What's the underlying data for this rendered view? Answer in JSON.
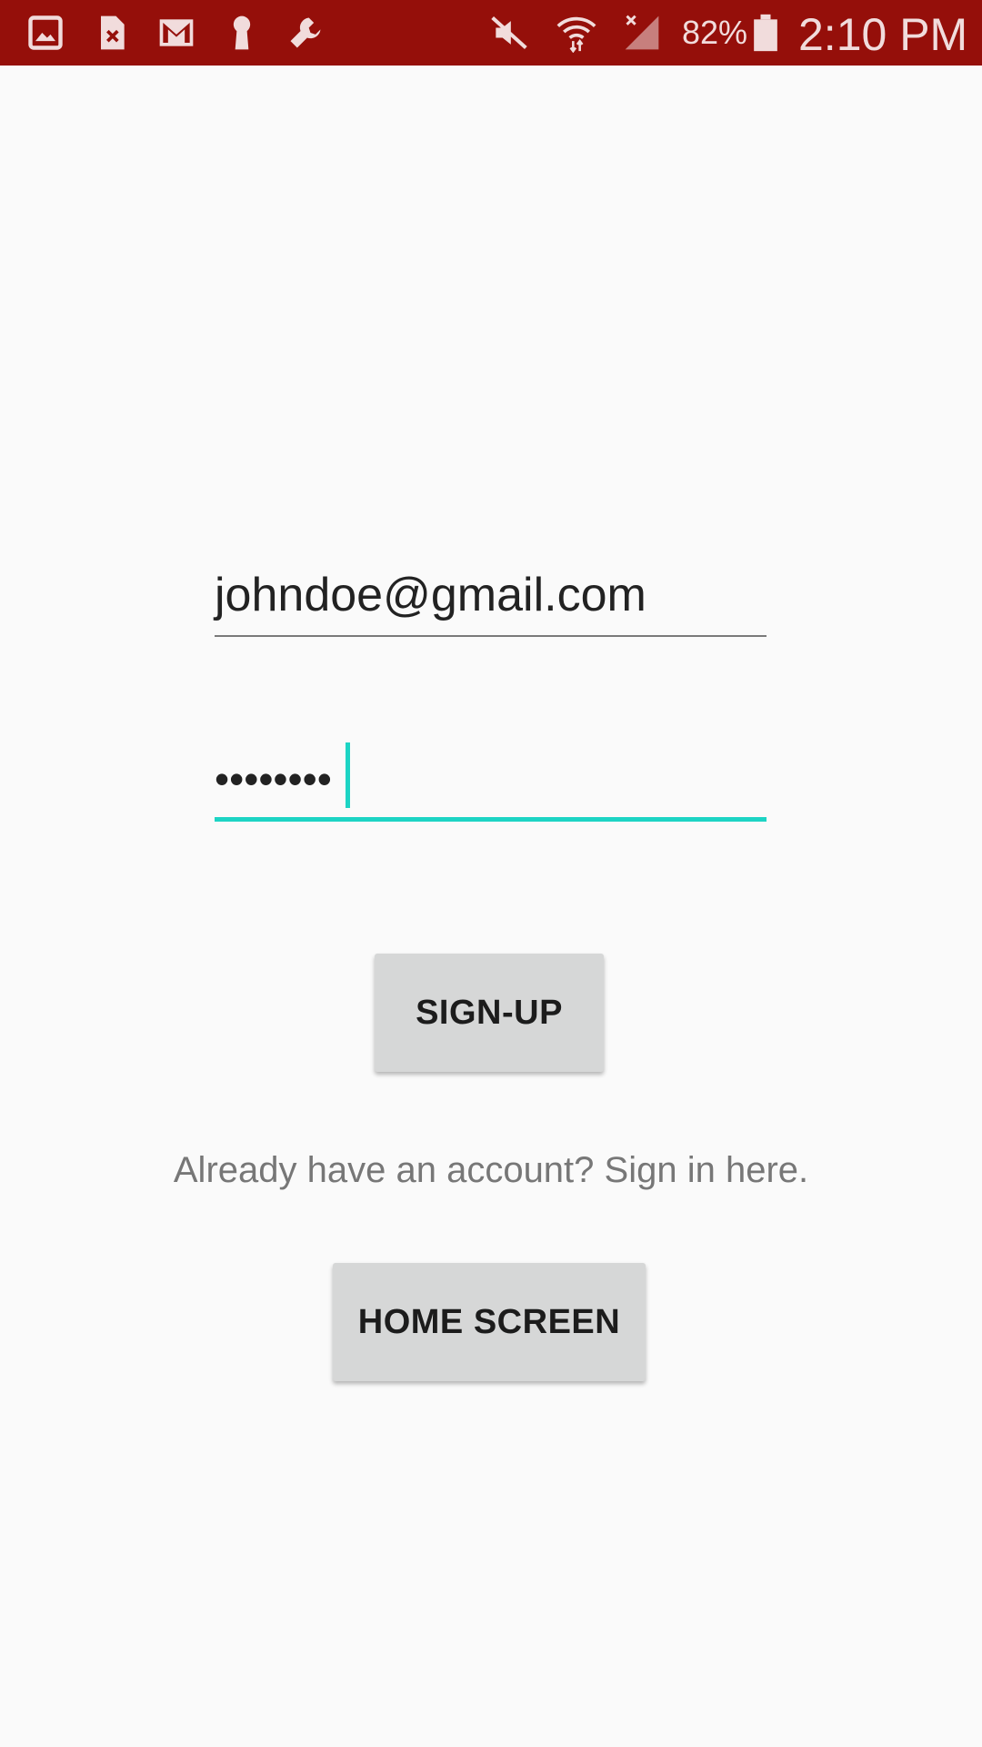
{
  "status_bar": {
    "background": "#950f0a",
    "left_icons": [
      "gallery-icon",
      "sim-error-icon",
      "gmail-icon",
      "keyhole-icon",
      "wrench-icon"
    ],
    "right_icons": [
      "mute-icon",
      "wifi-icon",
      "no-signal-icon",
      "battery-icon"
    ],
    "battery_percent": "82%",
    "time": "2:10 PM"
  },
  "form": {
    "email_value": "johndoe@gmail.com",
    "password_value": "••••••••",
    "focus_color": "#1dd4c4"
  },
  "buttons": {
    "signup_label": "SIGN-UP",
    "home_label": "HOME SCREEN"
  },
  "signin_text": "Already have an account? Sign in here."
}
